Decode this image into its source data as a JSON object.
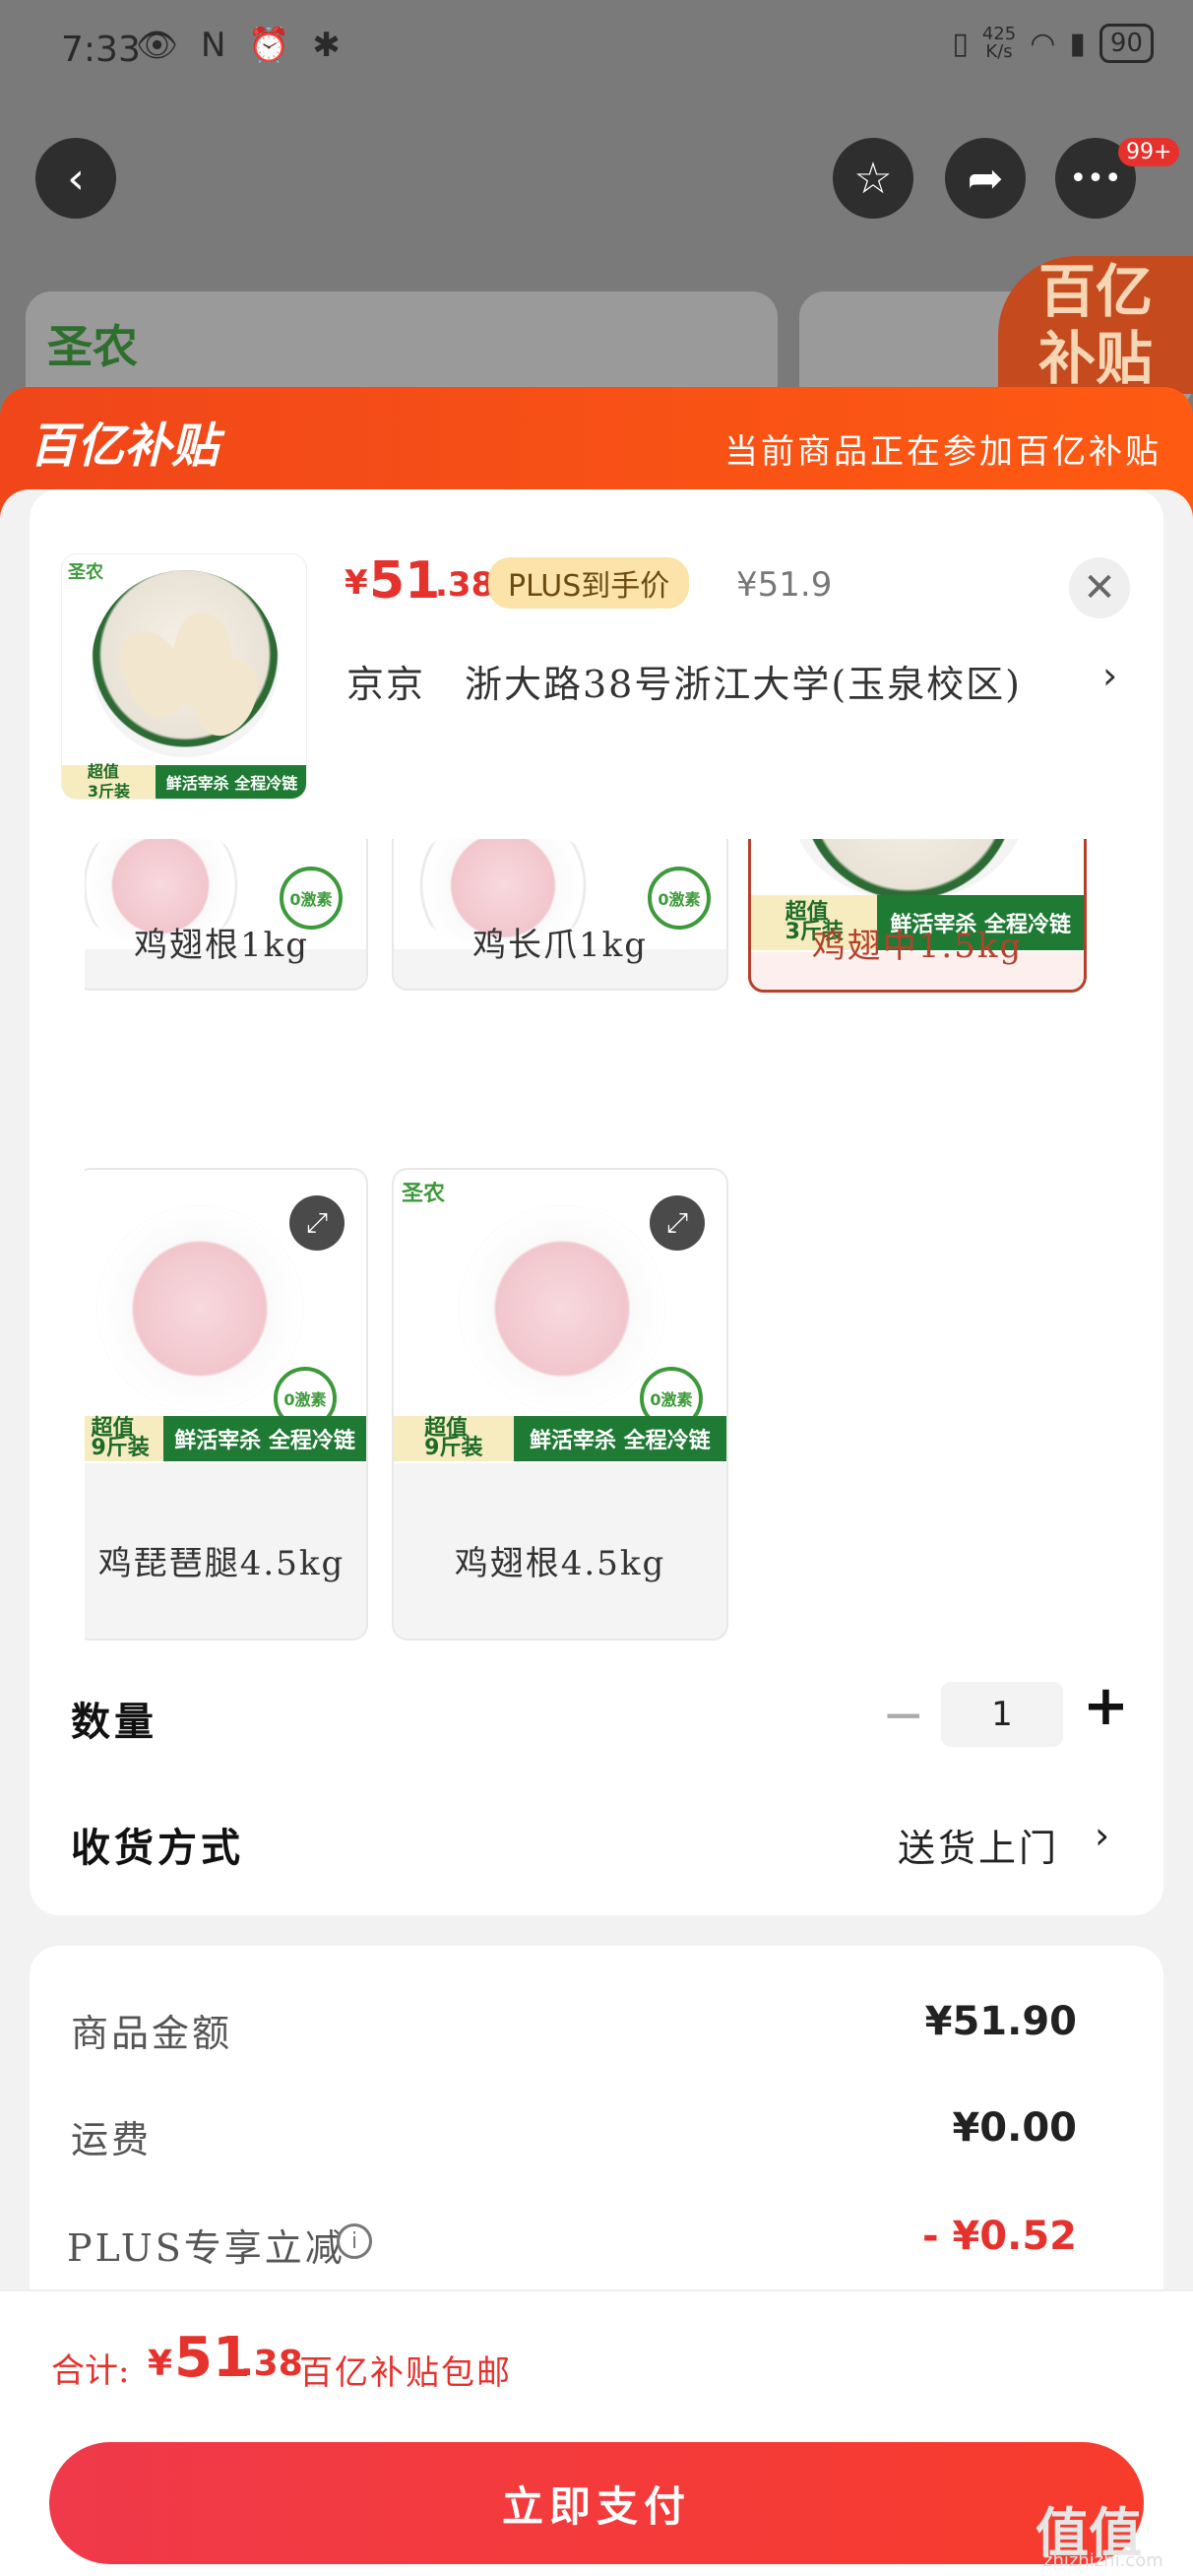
{
  "status_bar": {
    "time": "7:33",
    "left_icons": "👁 N ⏰ ✱",
    "net_speed": "425\nK/s",
    "battery": "90"
  },
  "top_nav": {
    "back_icon": "‹",
    "fav_icon": "☆",
    "share_icon": "➦",
    "more_icon": "•••",
    "more_badge": "99+"
  },
  "background": {
    "brand": "圣农",
    "subsidy_line1": "百亿",
    "subsidy_line2": "补贴"
  },
  "banner": {
    "logo": "百亿补贴",
    "text": "当前商品正在参加百亿补贴"
  },
  "product": {
    "brand": "圣农",
    "currency": "¥",
    "price_int": "51",
    "price_dec": ".38",
    "plus_tag": "PLUS到手价",
    "original_price": "¥51.9",
    "close_icon": "✕",
    "address": "京京　浙大路38号浙江大学(玉泉校区)",
    "address_arrow": "›",
    "thumb_badge_l": "超值\n3斤装",
    "thumb_badge_r": "鲜活宰杀 全程冷链"
  },
  "variants": [
    {
      "label": "鸡翅根1kg",
      "selected": false
    },
    {
      "label": "鸡长爪1kg",
      "selected": false
    },
    {
      "label": "鸡翅中1.5kg",
      "selected": true,
      "badge_l": "超值\n3斤装",
      "badge_r": "鲜活宰杀 全程冷链"
    },
    {
      "label": "鸡琵琶腿4.5kg",
      "selected": false,
      "badge_l": "超值\n9斤装",
      "badge_r": "鲜活宰杀 全程冷链",
      "zero_text": "0激素"
    },
    {
      "label": "鸡翅根4.5kg",
      "selected": false,
      "brand": "圣农",
      "badge_l": "超值\n9斤装",
      "badge_r": "鲜活宰杀 全程冷链",
      "zero_text": "0激素"
    }
  ],
  "expand_icon": "⤢",
  "quantity": {
    "label": "数量",
    "minus": "−",
    "value": "1",
    "plus": "+"
  },
  "delivery": {
    "label": "收货方式",
    "value": "送货上门",
    "arrow": "›"
  },
  "fees": {
    "goods_label": "商品金额",
    "goods_value": "¥51.90",
    "shipping_label": "运费",
    "shipping_value": "¥0.00",
    "plus_label": "PLUS专享立减",
    "plus_value": "- ¥0.52",
    "info_icon": "i"
  },
  "total": {
    "label": "合计:",
    "currency": "¥",
    "int": "51",
    "dec": ".38",
    "note": "百亿补贴包邮"
  },
  "pay_button": "立即支付",
  "watermark": {
    "main": "值值值",
    "sub": "zhizhizhi.com"
  },
  "colors": {
    "accent_red": "#e5322d",
    "banner_orange": "#f0461a",
    "selected_border": "#b5412c",
    "brand_green": "#1f7a34"
  }
}
